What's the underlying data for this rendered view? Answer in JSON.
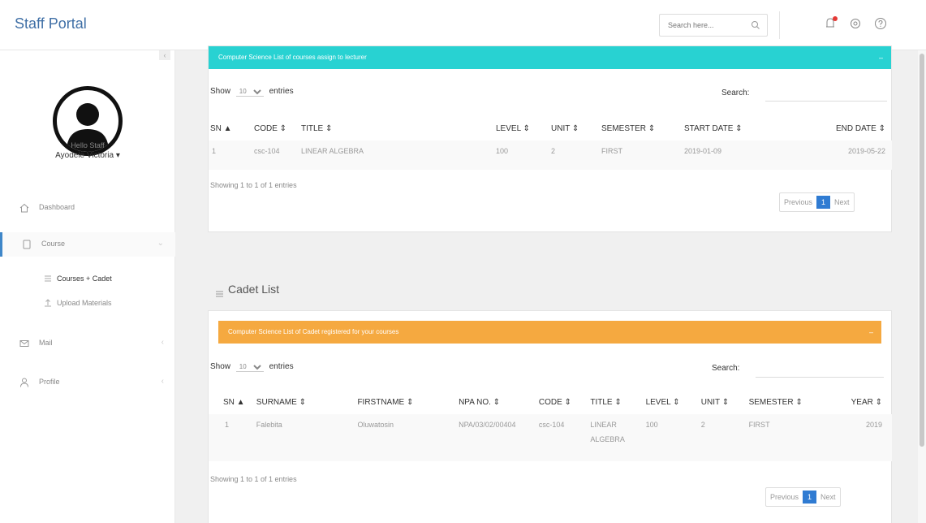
{
  "header": {
    "brand": "Staff Portal",
    "search_placeholder": "Search here...",
    "icons": [
      "notification-icon",
      "settings-icon",
      "help-icon"
    ]
  },
  "sidebar": {
    "hello": "Hello Staff",
    "username": "Ayodele Victoria ▾",
    "items": [
      {
        "label": "Dashboard",
        "icon": "home-icon"
      },
      {
        "label": "Course",
        "icon": "tablet-icon",
        "active": true
      },
      {
        "label": "Mail",
        "icon": "mail-icon"
      },
      {
        "label": "Profile",
        "icon": "user-icon"
      }
    ],
    "subitems": [
      {
        "label": "Courses + Cadet",
        "icon": "list-icon",
        "current": true
      },
      {
        "label": "Upload Materials",
        "icon": "upload-icon"
      }
    ]
  },
  "courses_panel": {
    "heading": "Computer Science List of courses assign to lecturer",
    "color": "#28d2d2",
    "show_label": "Show",
    "entries_value": "10",
    "entries_label": "entries",
    "search_label": "Search:",
    "columns": [
      "SN ▲",
      "CODE ⇕",
      "TITLE ⇕",
      "LEVEL ⇕",
      "UNIT ⇕",
      "SEMESTER ⇕",
      "START DATE ⇕",
      "END DATE ⇕"
    ],
    "rows": [
      [
        "1",
        "csc-104",
        "LINEAR ALGEBRA",
        "100",
        "2",
        "FIRST",
        "2019-01-09",
        "2019-05-22"
      ]
    ],
    "info": "Showing 1 to 1 of 1 entries",
    "prev": "Previous",
    "page": "1",
    "next": "Next"
  },
  "cadet_section": {
    "title": "Cadet List"
  },
  "cadet_panel": {
    "heading": "Computer Science List of Cadet registered for your courses",
    "color": "#f5a940",
    "show_label": "Show",
    "entries_value": "10",
    "entries_label": "entries",
    "search_label": "Search:",
    "columns": [
      "SN ▲",
      "SURNAME ⇕",
      "FIRSTNAME ⇕",
      "NPA NO. ⇕",
      "CODE ⇕",
      "TITLE ⇕",
      "LEVEL ⇕",
      "UNIT ⇕",
      "SEMESTER ⇕",
      "YEAR ⇕"
    ],
    "rows": [
      [
        "1",
        "Falebita",
        "Oluwatosin",
        "NPA/03/02/00404",
        "csc-104",
        "LINEAR ALGEBRA",
        "100",
        "2",
        "FIRST",
        "2019"
      ]
    ],
    "info": "Showing 1 to 1 of 1 entries",
    "prev": "Previous",
    "page": "1",
    "next": "Next"
  }
}
